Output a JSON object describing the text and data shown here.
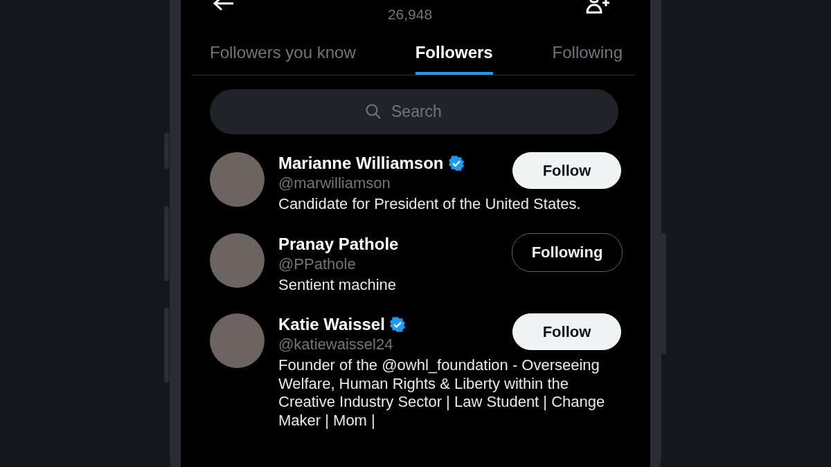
{
  "header": {
    "count": "26,948"
  },
  "tabs": [
    {
      "label": "Followers you know",
      "selected": false
    },
    {
      "label": "Followers",
      "selected": true
    },
    {
      "label": "Following",
      "selected": false
    }
  ],
  "search": {
    "placeholder": "Search"
  },
  "users": [
    {
      "name": "Marianne Williamson",
      "verified": true,
      "handle": "@marwilliamson",
      "bio": "Candidate for President of the United States.",
      "following": false,
      "button": "Follow"
    },
    {
      "name": "Pranay Pathole",
      "verified": false,
      "handle": "@PPathole",
      "bio": "Sentient machine",
      "following": true,
      "button": "Following"
    },
    {
      "name": "Katie Waissel",
      "verified": true,
      "handle": "@katiewaissel24",
      "bio": "Founder of the @owhl_foundation - Overseeing Welfare, Human Rights & Liberty within the Creative Industry Sector | Law Student | Change Maker | Mom |",
      "following": false,
      "button": "Follow"
    }
  ]
}
